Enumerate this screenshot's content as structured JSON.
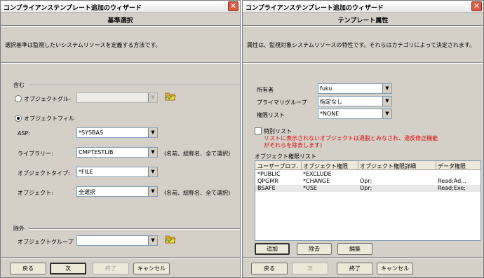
{
  "left": {
    "window_title": "コンプライアンステンプレート追加のウィザード",
    "close_glyph": "✕",
    "page_title": "基準選択",
    "description": "選択基準は監視したいシステムリソースを定義する方法です。",
    "include_label": "含む",
    "radio_object_group": "オブジェクトグル-",
    "radio_object_filter": "オブジェクトフィル",
    "asp_label": "ASP:",
    "asp_value": "*SYSBAS",
    "library_label": "ライブラリー:",
    "library_value": "CMPTESTLIB",
    "library_hint": "(名前、総称名、全て選択)",
    "object_type_label": "オブジェクトタイプ:",
    "object_type_value": "*FILE",
    "object_label": "オブジェクト:",
    "object_value": "全選択",
    "object_hint": "(名前、総称名、全て選択)",
    "exclude_label": "除外",
    "exclude_group_label": "オブジェクトグループ",
    "buttons": {
      "back": "戻る",
      "next": "次",
      "finish": "終了",
      "cancel": "キャンセル"
    }
  },
  "right": {
    "window_title": "コンプライアンステンプレート追加のウィザード",
    "close_glyph": "✕",
    "page_title": "テンプレート属性",
    "description": "属性は、監視対象システムリソースの特性です。それらはカテゴリによって決定されます。",
    "owner_label": "所有者",
    "owner_value": "fuku",
    "primary_group_label": "プライマリグループ",
    "primary_group_value": "指定なし",
    "authority_list_label": "権限リスト",
    "authority_list_value": "*NONE",
    "special_list_label": "特別リスト",
    "warning_line1": "リストに表示されないオブジェクトは違脱とみなされ、違反修正機能",
    "warning_line2": "がそれらを除去します)",
    "object_authority_list_label": "オブジェクト権限リスト",
    "columns": [
      "ユーザープロフ...",
      "オブジェクト権限",
      "オブジェクト権限詳細",
      "データ権限"
    ],
    "rows": [
      [
        "*PUBLIC",
        "*EXCLUDE",
        "",
        ""
      ],
      [
        "QPGMR",
        "*CHANGE",
        "Opr;",
        "Read;Ad..."
      ],
      [
        "BSAFE",
        "*USE",
        "Opr;",
        "Read;Exe;"
      ]
    ],
    "buttons": {
      "add": "追加",
      "remove": "除去",
      "edit": "編集",
      "back": "戻る",
      "next": "次",
      "finish": "終了",
      "cancel": "キャンセル"
    }
  },
  "icons": {
    "folder": "folder-open-icon",
    "chevron": "▼"
  }
}
